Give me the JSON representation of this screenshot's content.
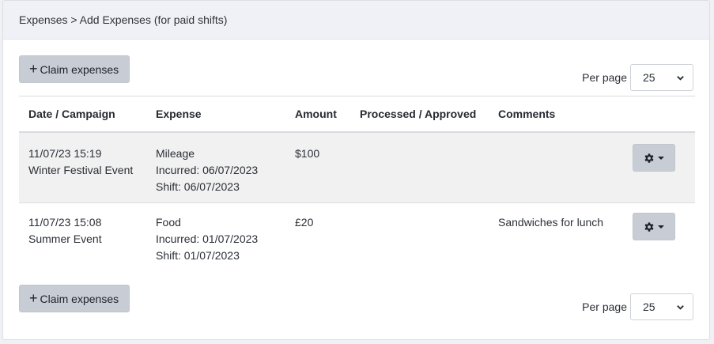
{
  "breadcrumb": "Expenses > Add Expenses (for paid shifts)",
  "claim_button_label": "Claim expenses",
  "per_page": {
    "label": "Per page",
    "value": "25"
  },
  "columns": [
    "Date / Campaign",
    "Expense",
    "Amount",
    "Processed / Approved",
    "Comments"
  ],
  "rows": [
    {
      "datetime": "11/07/23 15:19",
      "campaign": "Winter Festival Event",
      "expense_type": "Mileage",
      "incurred": "Incurred: 06/07/2023",
      "shift": "Shift: 06/07/2023",
      "amount": "$100",
      "processed": "",
      "comments": ""
    },
    {
      "datetime": "11/07/23 15:08",
      "campaign": "Summer Event",
      "expense_type": "Food",
      "incurred": "Incurred: 01/07/2023",
      "shift": "Shift: 01/07/2023",
      "amount": "£20",
      "processed": "",
      "comments": "Sandwiches for lunch"
    }
  ],
  "icons": {
    "plus": "plus-icon",
    "gear": "gear-icon",
    "caret": "caret-down-icon",
    "select": "chevron-down-icon"
  }
}
